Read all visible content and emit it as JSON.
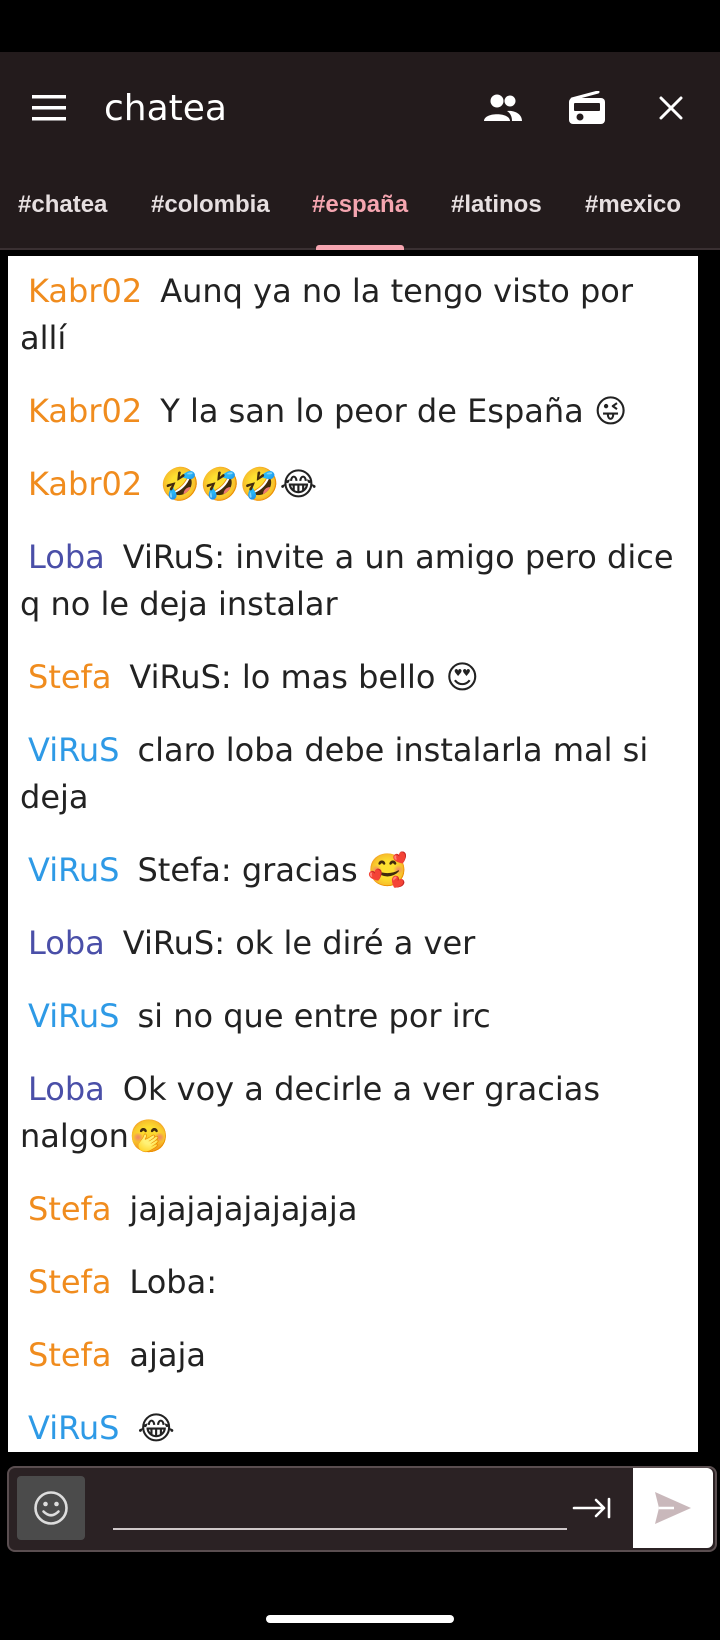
{
  "app": {
    "title": "chatea"
  },
  "icons": {
    "menu": "hamburger-menu-icon",
    "users": "users-icon",
    "radio": "radio-icon",
    "close": "close-icon",
    "emoji": "smiley-icon",
    "tab_complete": "tab-arrow-icon",
    "send": "send-icon"
  },
  "tabs": [
    {
      "label": "#chatea",
      "active": false
    },
    {
      "label": "#colombia",
      "active": false
    },
    {
      "label": "#españa",
      "active": true
    },
    {
      "label": "#latinos",
      "active": false
    },
    {
      "label": "#mexico",
      "active": false
    }
  ],
  "messages": [
    {
      "nick": "Kabr02",
      "color": "orange",
      "text": "Aunq ya no la tengo visto por allí"
    },
    {
      "nick": "Kabr02",
      "color": "orange",
      "text": "Y la san lo peor de España 😜"
    },
    {
      "nick": "Kabr02",
      "color": "orange",
      "text": "🤣🤣🤣😂"
    },
    {
      "nick": "Loba",
      "color": "purple",
      "text": "ViRuS: invite a un amigo pero dice q no le deja instalar"
    },
    {
      "nick": "Stefa",
      "color": "orange",
      "text": "ViRuS: lo mas bello 😍"
    },
    {
      "nick": "ViRuS",
      "color": "blue",
      "text": "claro loba debe instalarla mal si deja"
    },
    {
      "nick": "ViRuS",
      "color": "blue",
      "text": "Stefa:  gracias 🥰"
    },
    {
      "nick": "Loba",
      "color": "purple",
      "text": "ViRuS: ok le diré a ver"
    },
    {
      "nick": "ViRuS",
      "color": "blue",
      "text": "si no que entre por irc"
    },
    {
      "nick": "Loba",
      "color": "purple",
      "text": "Ok voy a decirle a ver gracias nalgon🤭"
    },
    {
      "nick": "Stefa",
      "color": "orange",
      "text": "jajajajajajajaja"
    },
    {
      "nick": "Stefa",
      "color": "orange",
      "text": "Loba:"
    },
    {
      "nick": "Stefa",
      "color": "orange",
      "text": "ajaja"
    },
    {
      "nick": "ViRuS",
      "color": "blue",
      "text": "😂"
    }
  ],
  "input": {
    "value": "",
    "placeholder": ""
  },
  "colors": {
    "appbar": "#231b1c",
    "accent": "#f5a5b0",
    "nick_orange": "#f08c1e",
    "nick_purple": "#4a4fa8",
    "nick_blue": "#2e9ae6"
  }
}
